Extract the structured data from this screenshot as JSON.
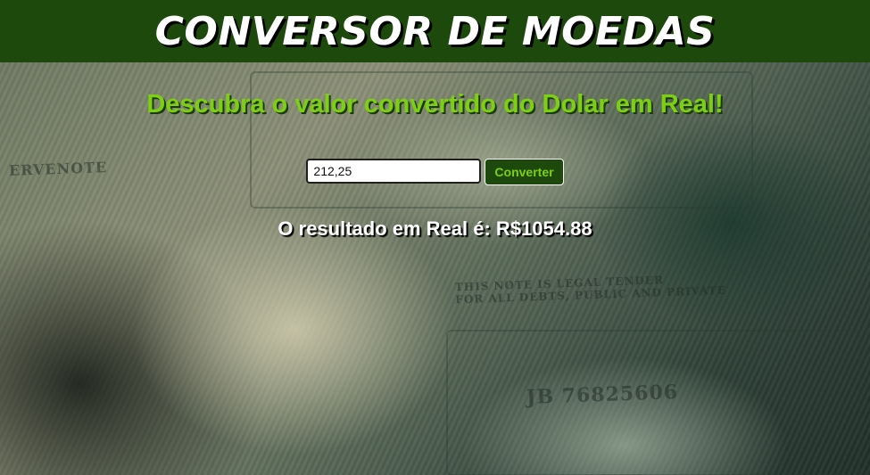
{
  "header": {
    "title": "CONVERSOR DE MOEDAS"
  },
  "main": {
    "subtitle": "Descubra o valor convertido do Dolar em Real!",
    "amount_input": {
      "value": "212,25"
    },
    "convert_button_label": "Converter",
    "result_text": "O resultado em Real é: R$1054.88"
  },
  "colors": {
    "header_bg": "#1d4a0c",
    "accent_green": "#7ccf12",
    "title_text": "#ffffff"
  }
}
